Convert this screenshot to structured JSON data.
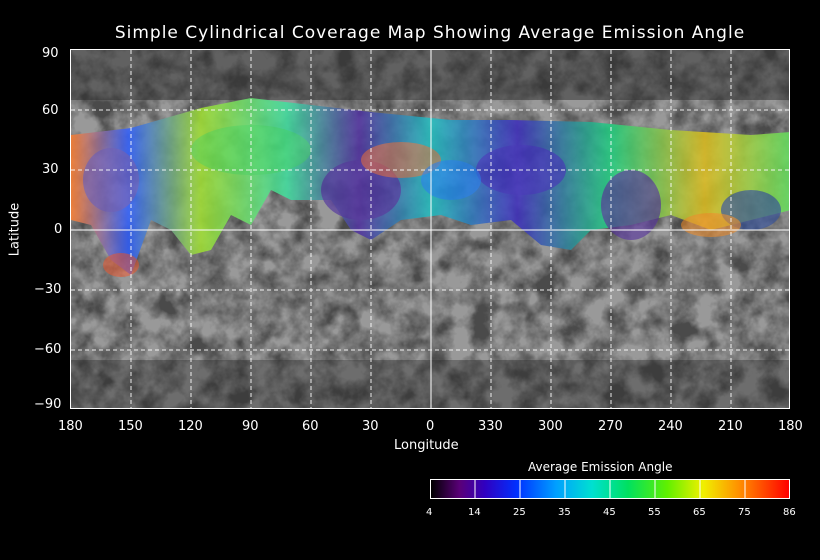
{
  "title": "Simple Cylindrical Coverage Map Showing Average Emission Angle",
  "axes": {
    "xlabel": "Longitude",
    "ylabel": "Latitude",
    "x_ticks": [
      "180",
      "150",
      "120",
      "90",
      "60",
      "30",
      "0",
      "330",
      "300",
      "270",
      "240",
      "210",
      "180"
    ],
    "y_ticks": [
      "90",
      "60",
      "30",
      "0",
      "−30",
      "−60",
      "−90"
    ]
  },
  "colorbar": {
    "title": "Average Emission Angle",
    "ticks": [
      "4",
      "14",
      "25",
      "35",
      "45",
      "55",
      "65",
      "75",
      "86"
    ],
    "range": [
      4,
      86
    ]
  },
  "colors": {
    "grid": "#ffffff",
    "background": "#000000"
  },
  "coverage_note_visible": false
}
